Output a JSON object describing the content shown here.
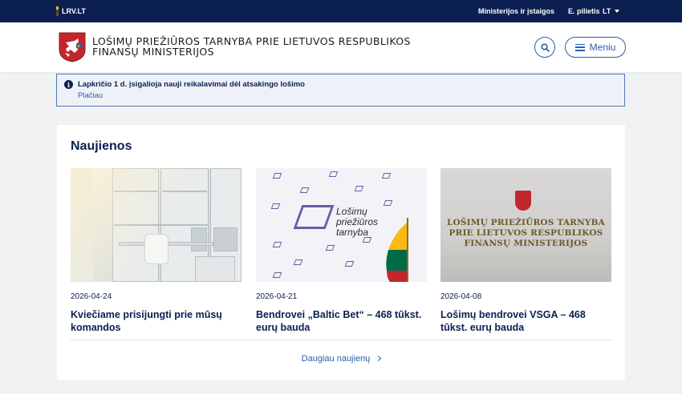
{
  "topbar": {
    "site": "LRV.LT",
    "links": [
      "Ministerijos ir įstaigos",
      "E. pilietis"
    ],
    "lang": "LT"
  },
  "header": {
    "org_name": "LOŠIMŲ PRIEŽIŪROS TARNYBA PRIE LIETUVOS RESPUBLIKOS FINANSŲ MINISTERIJOS",
    "menu_label": "Meniu"
  },
  "alert": {
    "message": "Lapkričio 1 d. įsigalioja nauji reikalavimai dėl atsakingo lošimo",
    "link": "Plačiau"
  },
  "news": {
    "heading": "Naujienos",
    "items": [
      {
        "date": "2026-04-24",
        "title": "Kviečiame prisijungti prie mūsų komandos"
      },
      {
        "date": "2026-04-21",
        "title": "Bendrovei „Baltic Bet“ – 468 tūkst. eurų bauda"
      },
      {
        "date": "2026-04-08",
        "title": "Lošimų bendrovei VSGA – 468 tūkst. eurų bauda"
      }
    ],
    "more_link": "Daugiau naujienų",
    "image2_logo_text": "Lošimų priežiūros tarnyba",
    "image3_sign_text": "LOŠIMŲ PRIEŽIŪROS TARNYBA PRIE LIETUVOS RESPUBLIKOS FINANSŲ MINISTERIJOS"
  },
  "colors": {
    "navy": "#0b1f51",
    "accent_blue": "#2a5db0",
    "alert_border": "#4f76bb",
    "flag_yellow": "#fdb913",
    "flag_green": "#006a44",
    "flag_red": "#c1272d"
  }
}
